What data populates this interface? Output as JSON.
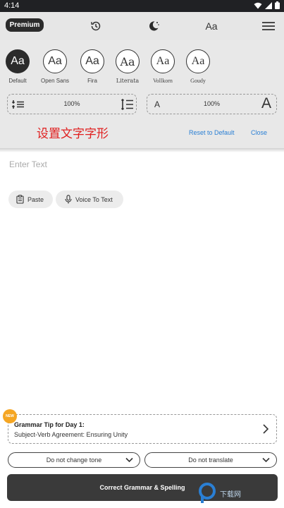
{
  "status_bar": {
    "time": "4:14"
  },
  "top_bar": {
    "premium_label": "Premium",
    "font_label": "Aa"
  },
  "fonts": {
    "sample": "Aa",
    "options": [
      {
        "label": "Default"
      },
      {
        "label": "Open Sans"
      },
      {
        "label": "Fira"
      },
      {
        "label": "Literata"
      },
      {
        "label": "Vollkorn"
      },
      {
        "label": "Goudy"
      }
    ]
  },
  "line_spacing": {
    "value": "100%"
  },
  "text_size": {
    "value": "100%",
    "small_label": "A",
    "large_label": "A"
  },
  "panel": {
    "caption": "设置文字字形",
    "reset_label": "Reset to Default",
    "close_label": "Close"
  },
  "editor": {
    "placeholder": "Enter Text"
  },
  "actions": {
    "paste_label": "Paste",
    "voice_label": "Voice To Text"
  },
  "tip": {
    "badge": "NEW",
    "title": "Grammar Tip for Day 1:",
    "body": "Subject-Verb Agreement: Ensuring Unity"
  },
  "tone_select": {
    "value": "Do not change tone"
  },
  "translate_select": {
    "value": "Do not translate"
  },
  "correct_button": {
    "label": "Correct Grammar & Spelling"
  },
  "watermark": {
    "text": "下载网"
  },
  "colors": {
    "accent_red": "#e02020",
    "link_blue": "#2a7fd4",
    "dark": "#2b2b2b",
    "badge_orange": "#f5a623"
  }
}
